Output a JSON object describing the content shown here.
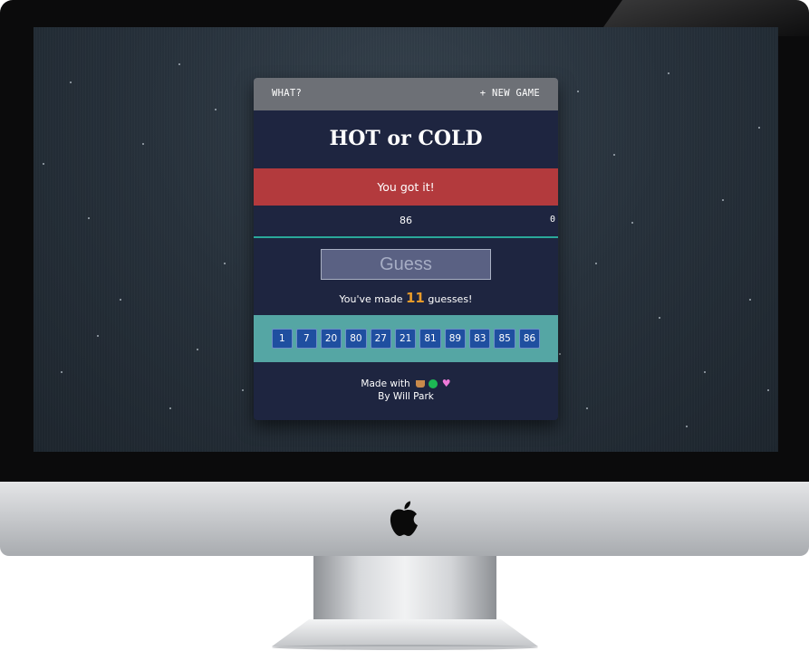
{
  "header": {
    "what_label": "WHAT?",
    "new_game_label": "+ NEW GAME"
  },
  "title": "HOT or COLD",
  "feedback": "You got it!",
  "guess_display": {
    "value": "86",
    "extra": "0"
  },
  "guess_button": "Guess",
  "guess_count": {
    "prefix": "You've made",
    "count": "11",
    "suffix": "guesses!"
  },
  "history": [
    "1",
    "7",
    "20",
    "80",
    "27",
    "21",
    "81",
    "89",
    "83",
    "85",
    "86"
  ],
  "footer": {
    "made_with": "Made with",
    "icons": [
      "coffee-icon",
      "spotify-icon",
      "heart-icon"
    ],
    "author": "By Will Park"
  },
  "colors": {
    "card_bg": "#1e2540",
    "topbar_bg": "#6d7076",
    "feedback_bg": "#b33a3d",
    "history_bg": "#55a6a4",
    "chip_bg": "#1f4fa0",
    "count_accent": "#e89b2a",
    "divider": "#2aa89a"
  }
}
